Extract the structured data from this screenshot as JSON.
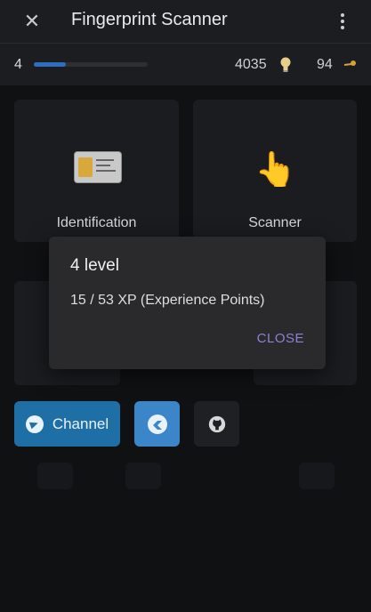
{
  "appbar": {
    "title": "Fingerprint Scanner"
  },
  "status": {
    "level": "4",
    "progress": 0.28,
    "xp_total": "4035",
    "coins": "94"
  },
  "cards": [
    {
      "label": "Identification",
      "icon": "id-card-icon"
    },
    {
      "label": "Scanner",
      "icon": "pointing-hand-icon"
    }
  ],
  "buttons": {
    "channel_label": "Channel"
  },
  "dialog": {
    "title": "4 level",
    "body": "15 / 53 XP (Experience Points)",
    "close_label": "CLOSE"
  },
  "colors": {
    "accent": "#2f6dc3",
    "dialog_action": "#8f7fd6",
    "channel": "#1d6fa5"
  }
}
